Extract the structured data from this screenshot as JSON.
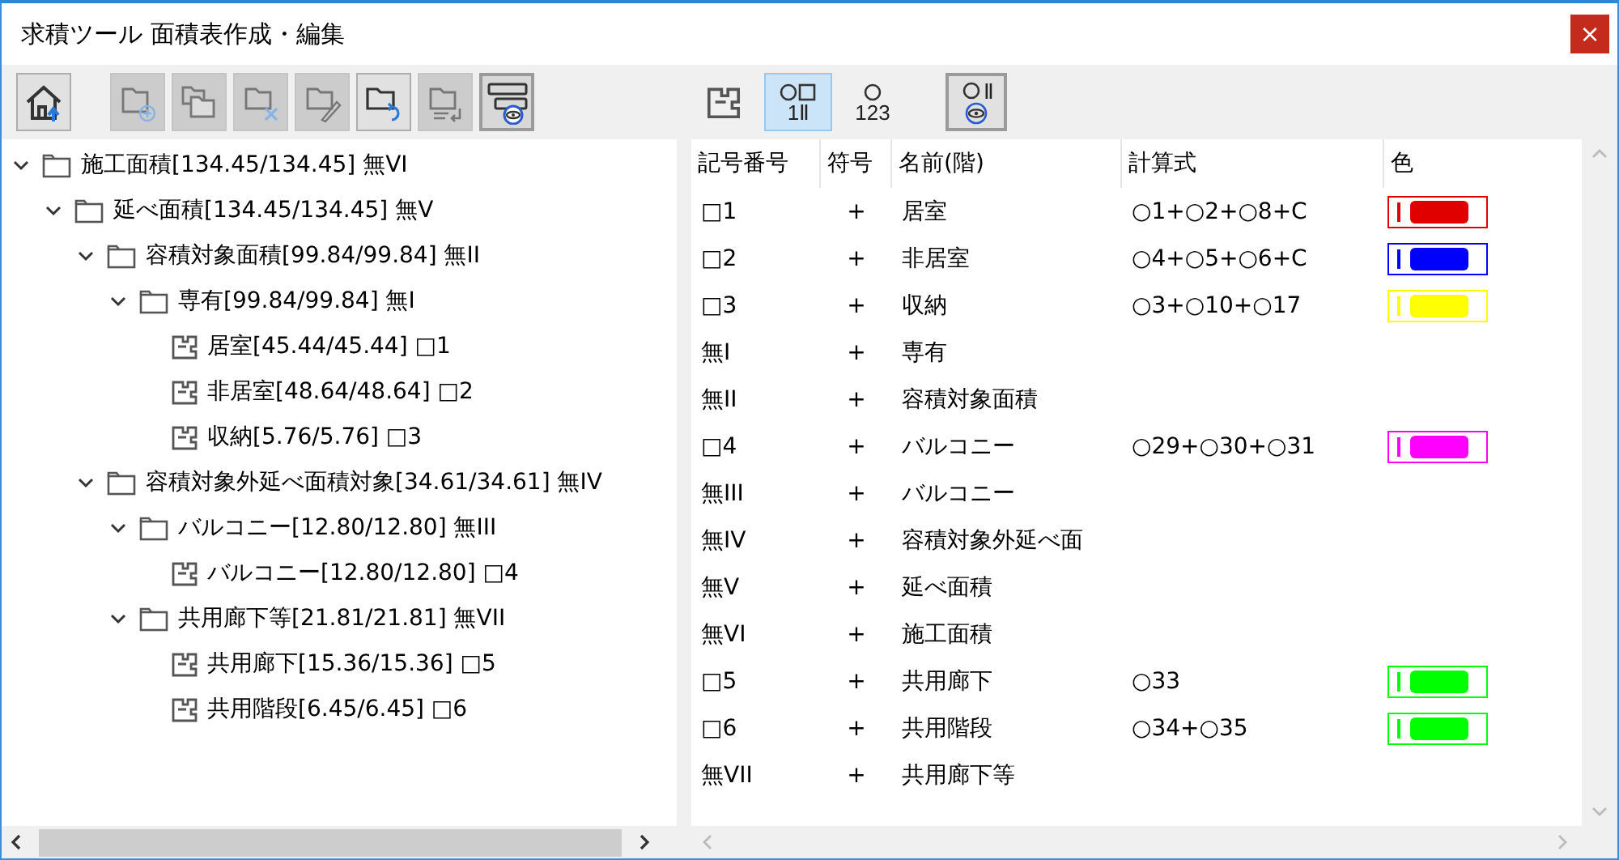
{
  "window": {
    "title": "求積ツール 面積表作成・編集",
    "close": "×"
  },
  "left_toolbar": [
    {
      "disabled": false,
      "pressed": false
    },
    {
      "disabled": true,
      "pressed": false
    },
    {
      "disabled": true,
      "pressed": false
    },
    {
      "disabled": true,
      "pressed": false
    },
    {
      "disabled": true,
      "pressed": false
    },
    {
      "disabled": false,
      "pressed": false
    },
    {
      "disabled": true,
      "pressed": false
    },
    {
      "disabled": false,
      "pressed": true
    }
  ],
  "right_toolbar": [
    {
      "selected": false,
      "pressed": false
    },
    {
      "selected": true,
      "pressed": false,
      "glyph": "1Ⅱ"
    },
    {
      "selected": false,
      "pressed": false,
      "glyph": "123"
    },
    {
      "selected": false,
      "pressed": true,
      "glyph": "Ⅱ"
    }
  ],
  "tree": [
    {
      "kind": "folder",
      "label": "施工面積[134.45/134.45] 無VI",
      "expanded": true,
      "children": [
        {
          "kind": "folder",
          "label": "延べ面積[134.45/134.45] 無V",
          "expanded": true,
          "children": [
            {
              "kind": "folder",
              "label": "容積対象面積[99.84/99.84] 無II",
              "expanded": true,
              "children": [
                {
                  "kind": "folder",
                  "label": "専有[99.84/99.84] 無I",
                  "expanded": true,
                  "children": [
                    {
                      "kind": "room",
                      "label": "居室[45.44/45.44] □1"
                    },
                    {
                      "kind": "room",
                      "label": "非居室[48.64/48.64] □2"
                    },
                    {
                      "kind": "room",
                      "label": "収納[5.76/5.76] □3"
                    }
                  ]
                }
              ]
            },
            {
              "kind": "folder",
              "label": "容積対象外延べ面積対象[34.61/34.61] 無IV",
              "expanded": true,
              "children": [
                {
                  "kind": "folder",
                  "label": "バルコニー[12.80/12.80] 無III",
                  "expanded": true,
                  "children": [
                    {
                      "kind": "room",
                      "label": "バルコニー[12.80/12.80] □4"
                    }
                  ]
                },
                {
                  "kind": "folder",
                  "label": "共用廊下等[21.81/21.81] 無VII",
                  "expanded": true,
                  "children": [
                    {
                      "kind": "room",
                      "label": "共用廊下[15.36/15.36] □5"
                    },
                    {
                      "kind": "room",
                      "label": "共用階段[6.45/6.45] □6"
                    }
                  ]
                }
              ]
            }
          ]
        }
      ]
    }
  ],
  "table": {
    "columns": [
      "記号番号",
      "符号",
      "名前(階)",
      "計算式",
      "色"
    ],
    "rows": [
      {
        "symbol": "□1",
        "sign": "+",
        "name": "居室",
        "formula": "○1+○2+○8+C",
        "color": "#e00000"
      },
      {
        "symbol": "□2",
        "sign": "+",
        "name": "非居室",
        "formula": "○4+○5+○6+C",
        "color": "#0000ff"
      },
      {
        "symbol": "□3",
        "sign": "+",
        "name": "収納",
        "formula": "○3+○10+○17",
        "color": "#ffff00"
      },
      {
        "symbol": "無I",
        "sign": "+",
        "name": "専有"
      },
      {
        "symbol": "無II",
        "sign": "+",
        "name": "容積対象面積"
      },
      {
        "symbol": "□4",
        "sign": "+",
        "name": "バルコニー",
        "formula": "○29+○30+○31",
        "color": "#ff00ff"
      },
      {
        "symbol": "無III",
        "sign": "+",
        "name": "バルコニー"
      },
      {
        "symbol": "無IV",
        "sign": "+",
        "name": "容積対象外延べ面"
      },
      {
        "symbol": "無V",
        "sign": "+",
        "name": "延べ面積"
      },
      {
        "symbol": "無VI",
        "sign": "+",
        "name": "施工面積"
      },
      {
        "symbol": "□5",
        "sign": "+",
        "name": "共用廊下",
        "formula": "○33",
        "color": "#00ff00"
      },
      {
        "symbol": "□6",
        "sign": "+",
        "name": "共用階段",
        "formula": "○34+○35",
        "color": "#00ff00"
      },
      {
        "symbol": "無VII",
        "sign": "+",
        "name": "共用廊下等"
      }
    ]
  }
}
